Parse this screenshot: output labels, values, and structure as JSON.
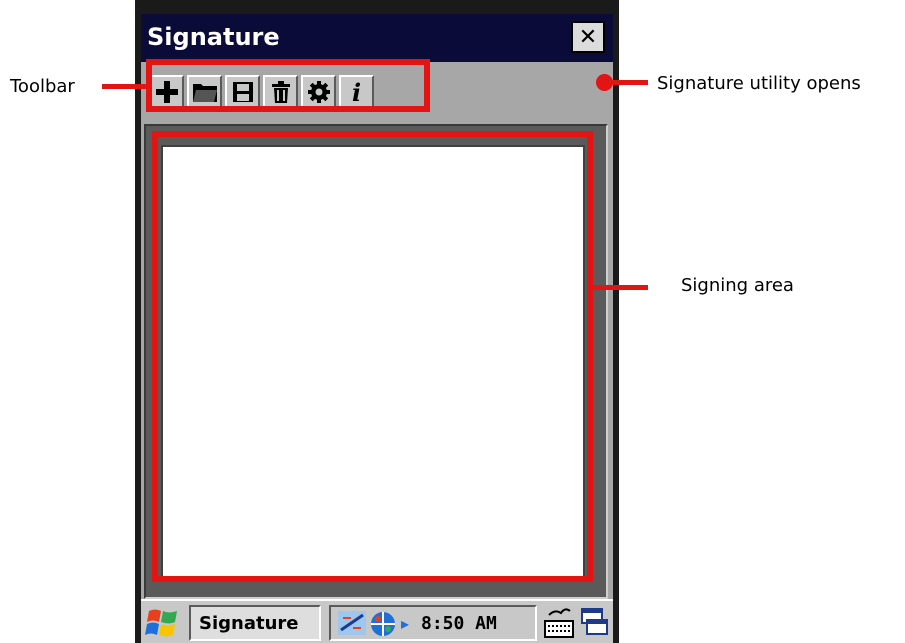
{
  "window": {
    "title": "Signature",
    "close_glyph": "✕"
  },
  "toolbar": {
    "buttons": [
      {
        "icon": "new-plus-icon"
      },
      {
        "icon": "open-folder-icon"
      },
      {
        "icon": "save-disk-icon"
      },
      {
        "icon": "trash-icon"
      },
      {
        "icon": "settings-gear-icon"
      },
      {
        "icon": "info-icon",
        "glyph": "i"
      }
    ]
  },
  "taskbar": {
    "task_label": "Signature",
    "time": "8:50 AM",
    "tray_arrow": "▸"
  },
  "annotations": {
    "toolbar": "Toolbar",
    "signature_utility": "Signature utility opens",
    "signing_area": "Signing area"
  },
  "colors": {
    "annotation": "#e31414",
    "titlebar": "#0b0b3a",
    "chrome": "#a7a7a7"
  }
}
